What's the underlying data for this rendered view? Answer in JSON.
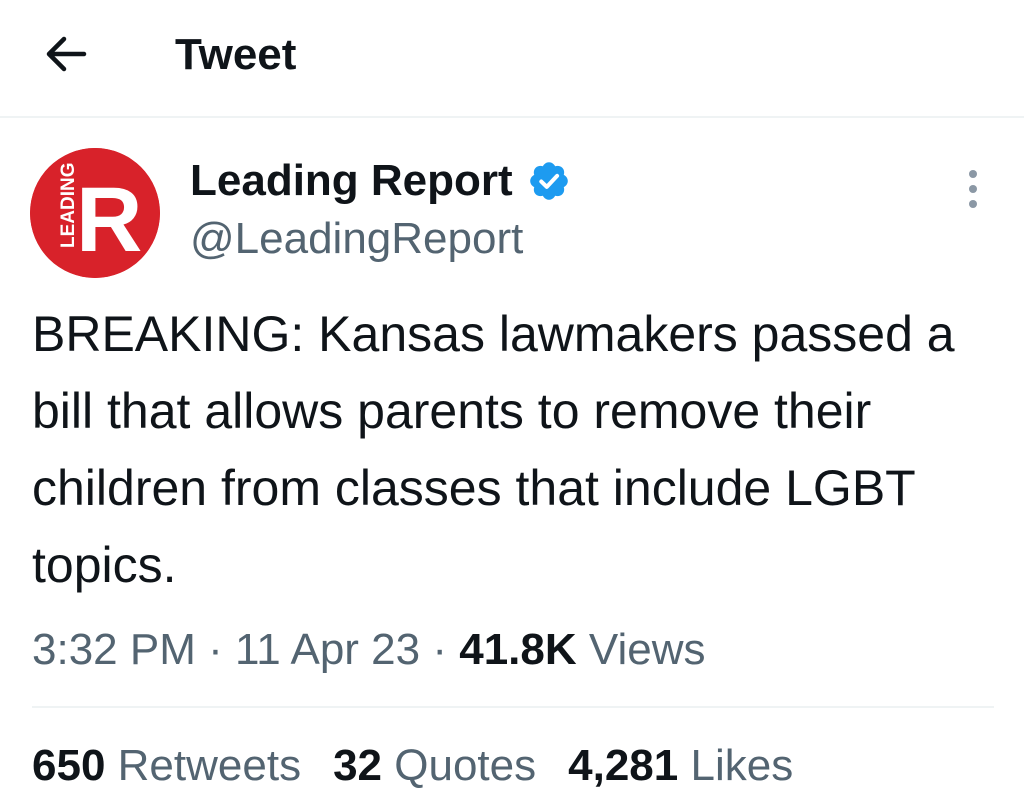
{
  "header": {
    "title": "Tweet",
    "back_icon": "arrow-left-icon"
  },
  "author": {
    "display_name": "Leading Report",
    "handle": "@LeadingReport",
    "verified": true,
    "avatar": {
      "letter": "R",
      "vertical_text": "LEADING",
      "color": "#d8222a"
    }
  },
  "more_icon": "more-vertical-icon",
  "tweet": {
    "text": "BREAKING: Kansas lawmakers passed a bill that allows parents to remove their children from classes that include LGBT topics."
  },
  "meta": {
    "time": "3:32 PM",
    "separator": "·",
    "date": "11 Apr 23",
    "views_count": "41.8K",
    "views_label": "Views"
  },
  "stats": {
    "retweets_count": "650",
    "retweets_label": "Retweets",
    "quotes_count": "32",
    "quotes_label": "Quotes",
    "likes_count": "4,281",
    "likes_label": "Likes"
  },
  "colors": {
    "text_primary": "#0f1419",
    "text_secondary": "#536471",
    "verified_blue": "#1d9bf0",
    "divider": "#eff3f4"
  }
}
